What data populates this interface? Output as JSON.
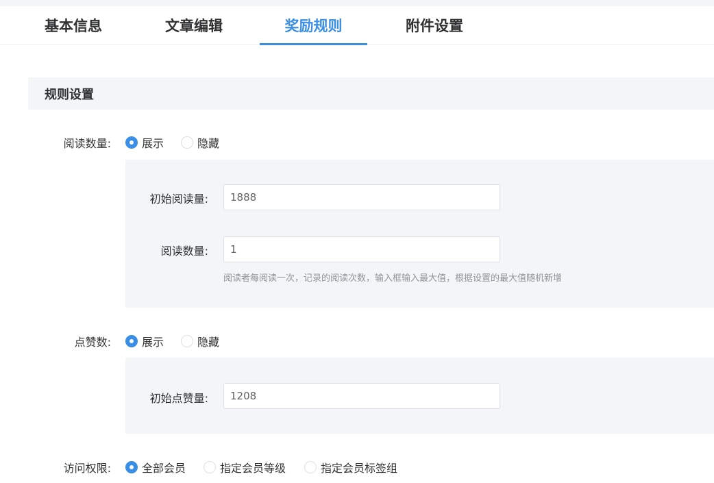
{
  "tabs": [
    {
      "label": "基本信息",
      "active": false
    },
    {
      "label": "文章编辑",
      "active": false
    },
    {
      "label": "奖励规则",
      "active": true
    },
    {
      "label": "附件设置",
      "active": false
    }
  ],
  "section": {
    "title": "规则设置"
  },
  "read_count": {
    "label": "阅读数量:",
    "options": [
      {
        "label": "展示",
        "checked": true
      },
      {
        "label": "隐藏",
        "checked": false
      }
    ],
    "initial_label": "初始阅读量:",
    "initial_value": "1888",
    "count_label": "阅读数量:",
    "count_value": "1",
    "hint": "阅读者每阅读一次，记录的阅读次数，输入框输入最大值，根据设置的最大值随机新增"
  },
  "likes": {
    "label": "点赞数:",
    "options": [
      {
        "label": "展示",
        "checked": true
      },
      {
        "label": "隐藏",
        "checked": false
      }
    ],
    "initial_label": "初始点赞量:",
    "initial_value": "1208"
  },
  "access": {
    "label": "访问权限:",
    "options": [
      {
        "label": "全部会员",
        "checked": true
      },
      {
        "label": "指定会员等级",
        "checked": false
      },
      {
        "label": "指定会员标签组",
        "checked": false
      }
    ]
  },
  "colors": {
    "accent": "#3a8ee6",
    "panel_bg": "#f4f5f7",
    "text": "#303133",
    "hint": "#909399"
  }
}
